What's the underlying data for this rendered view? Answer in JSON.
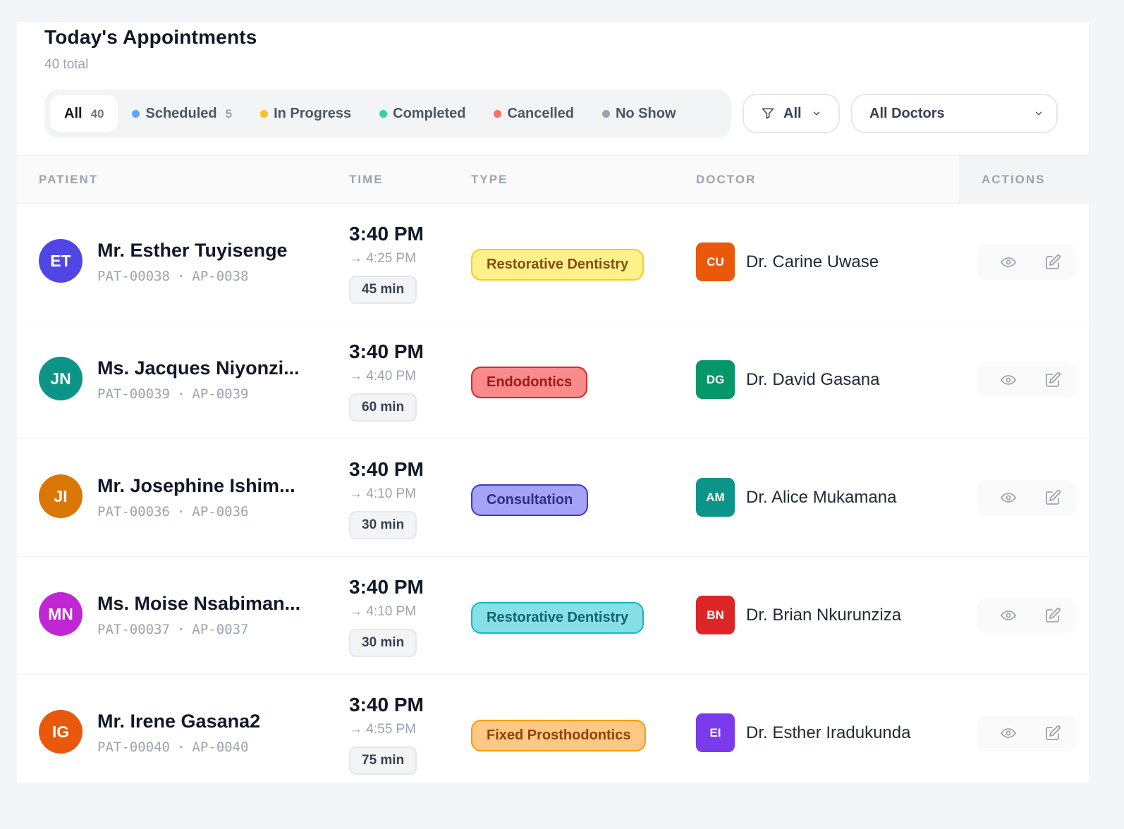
{
  "header": {
    "title": "Today's Appointments",
    "subtitle": "40 total"
  },
  "filters": [
    {
      "label": "All",
      "count": "40",
      "active": true,
      "dot": ""
    },
    {
      "label": "Scheduled",
      "count": "5",
      "active": false,
      "dot": "#60a5fa"
    },
    {
      "label": "In Progress",
      "count": "",
      "active": false,
      "dot": "#fbbf24"
    },
    {
      "label": "Completed",
      "count": "",
      "active": false,
      "dot": "#34d399"
    },
    {
      "label": "Cancelled",
      "count": "",
      "active": false,
      "dot": "#f87171"
    },
    {
      "label": "No Show",
      "count": "",
      "active": false,
      "dot": "#9ca3af"
    }
  ],
  "type_dropdown": {
    "label": "All",
    "icon": "filter-icon"
  },
  "doctor_dropdown": {
    "label": "All Doctors"
  },
  "columns": {
    "patient": "PATIENT",
    "time": "TIME",
    "type": "TYPE",
    "doctor": "DOCTOR",
    "actions": "ACTIONS"
  },
  "rows": [
    {
      "initials": "ET",
      "avatar_color": "#4f46e5",
      "name": "Mr. Esther Tuyisenge",
      "pat_id": "PAT-00038",
      "ap_id": "AP-0038",
      "start": "3:40 PM",
      "end": "→ 4:25 PM",
      "duration": "45 min",
      "type": "Restorative Dentistry",
      "type_bg": "#fef08a",
      "type_border": "#facc15",
      "type_color": "#854d0e",
      "doc_initials": "CU",
      "doc_color": "#ea580c",
      "doctor": "Dr. Carine Uwase"
    },
    {
      "initials": "JN",
      "avatar_color": "#0d9488",
      "name": "Ms. Jacques Niyonzi...",
      "pat_id": "PAT-00039",
      "ap_id": "AP-0039",
      "start": "3:40 PM",
      "end": "→ 4:40 PM",
      "duration": "60 min",
      "type": "Endodontics",
      "type_bg": "#f98b8b",
      "type_border": "#dc2626",
      "type_color": "#991b1b",
      "doc_initials": "DG",
      "doc_color": "#059669",
      "doctor": "Dr. David Gasana"
    },
    {
      "initials": "JI",
      "avatar_color": "#d97706",
      "name": "Mr. Josephine Ishim...",
      "pat_id": "PAT-00036",
      "ap_id": "AP-0036",
      "start": "3:40 PM",
      "end": "→ 4:10 PM",
      "duration": "30 min",
      "type": "Consultation",
      "type_bg": "#a5a3f7",
      "type_border": "#4338ca",
      "type_color": "#312e81",
      "doc_initials": "AM",
      "doc_color": "#0d9488",
      "doctor": "Dr. Alice Mukamana"
    },
    {
      "initials": "MN",
      "avatar_color": "#c026d3",
      "name": "Ms. Moise Nsabiman...",
      "pat_id": "PAT-00037",
      "ap_id": "AP-0037",
      "start": "3:40 PM",
      "end": "→ 4:10 PM",
      "duration": "30 min",
      "type": "Restorative Dentistry",
      "type_bg": "#86e0e6",
      "type_border": "#14b8c4",
      "type_color": "#155e75",
      "doc_initials": "BN",
      "doc_color": "#dc2626",
      "doctor": "Dr. Brian Nkurunziza"
    },
    {
      "initials": "IG",
      "avatar_color": "#ea580c",
      "name": "Mr. Irene Gasana2",
      "pat_id": "PAT-00040",
      "ap_id": "AP-0040",
      "start": "3:40 PM",
      "end": "→ 4:55 PM",
      "duration": "75 min",
      "type": "Fixed Prosthodontics",
      "type_bg": "#fdc883",
      "type_border": "#f59e0b",
      "type_color": "#92400e",
      "doc_initials": "EI",
      "doc_color": "#7c3aed",
      "doctor": "Dr. Esther Iradukunda"
    }
  ],
  "row_actions": {
    "view_icon": "eye-icon",
    "edit_icon": "edit-icon"
  }
}
